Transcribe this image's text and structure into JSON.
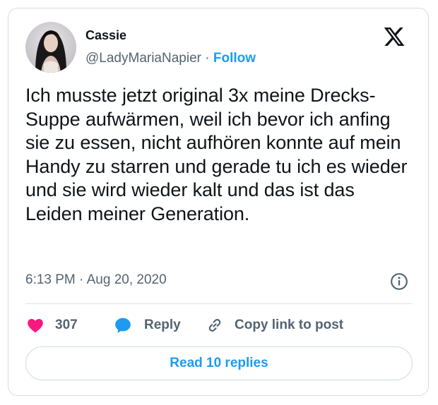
{
  "user": {
    "display_name": "Cassie",
    "handle": "@LadyMariaNapier",
    "separator": "·",
    "follow_label": "Follow"
  },
  "tweet": {
    "text": "Ich musste jetzt original 3x meine Drecks-Suppe aufwärmen, weil ich bevor ich anfing sie zu essen, nicht aufhören konnte auf mein Handy zu starren und gerade tu ich es wieder und sie wird wieder kalt und das ist das Leiden meiner Generation.",
    "time": "6:13 PM",
    "separator": "·",
    "date": "Aug 20, 2020"
  },
  "actions": {
    "like_count": "307",
    "reply_label": "Reply",
    "copy_link_label": "Copy link to post"
  },
  "read_replies_label": "Read 10 replies",
  "icons": {
    "brand": "x-logo-icon",
    "info": "info-icon",
    "like": "heart-icon",
    "reply": "speech-bubble-icon",
    "copy": "link-icon"
  },
  "colors": {
    "accent": "#1d9bf0",
    "like": "#f91880",
    "text": "#0f1419",
    "muted": "#536471",
    "border": "#d7dce0"
  }
}
